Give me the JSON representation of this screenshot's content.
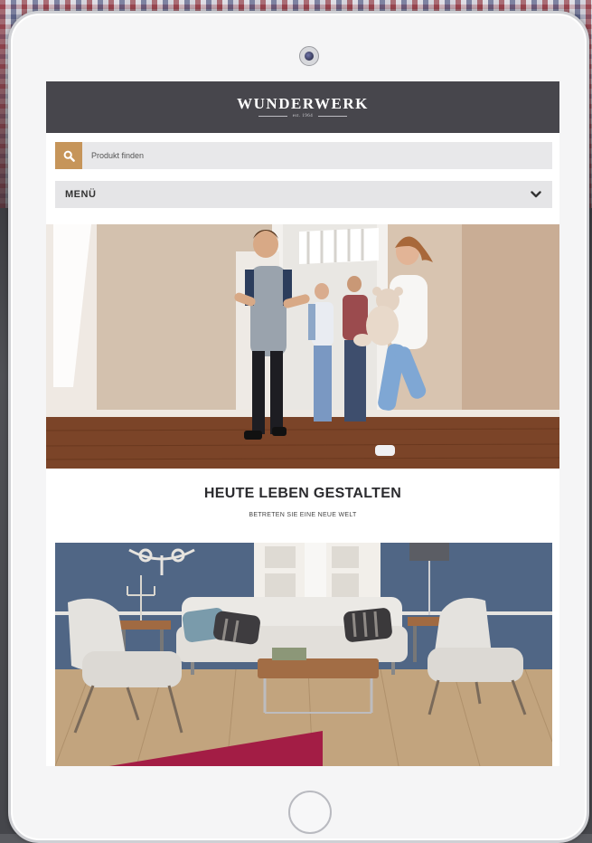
{
  "brand": {
    "name": "WUNDERWERK",
    "established": "est. 1964"
  },
  "search": {
    "placeholder": "Produkt finden",
    "icon": "search-icon"
  },
  "menu": {
    "label": "MENÜ",
    "icon": "chevron-down-icon"
  },
  "hero": {
    "image": "family-entering-new-home-photo"
  },
  "tagline": {
    "title": "HEUTE LEBEN GESTALTEN",
    "subtitle": "BETRETEN SIE EINE NEUE WELT"
  },
  "feature_image": "living-room-with-sofa-and-armchairs-photo",
  "colors": {
    "header_bg": "#47464c",
    "search_accent": "#c6955a",
    "accent_red": "#a31d45"
  }
}
